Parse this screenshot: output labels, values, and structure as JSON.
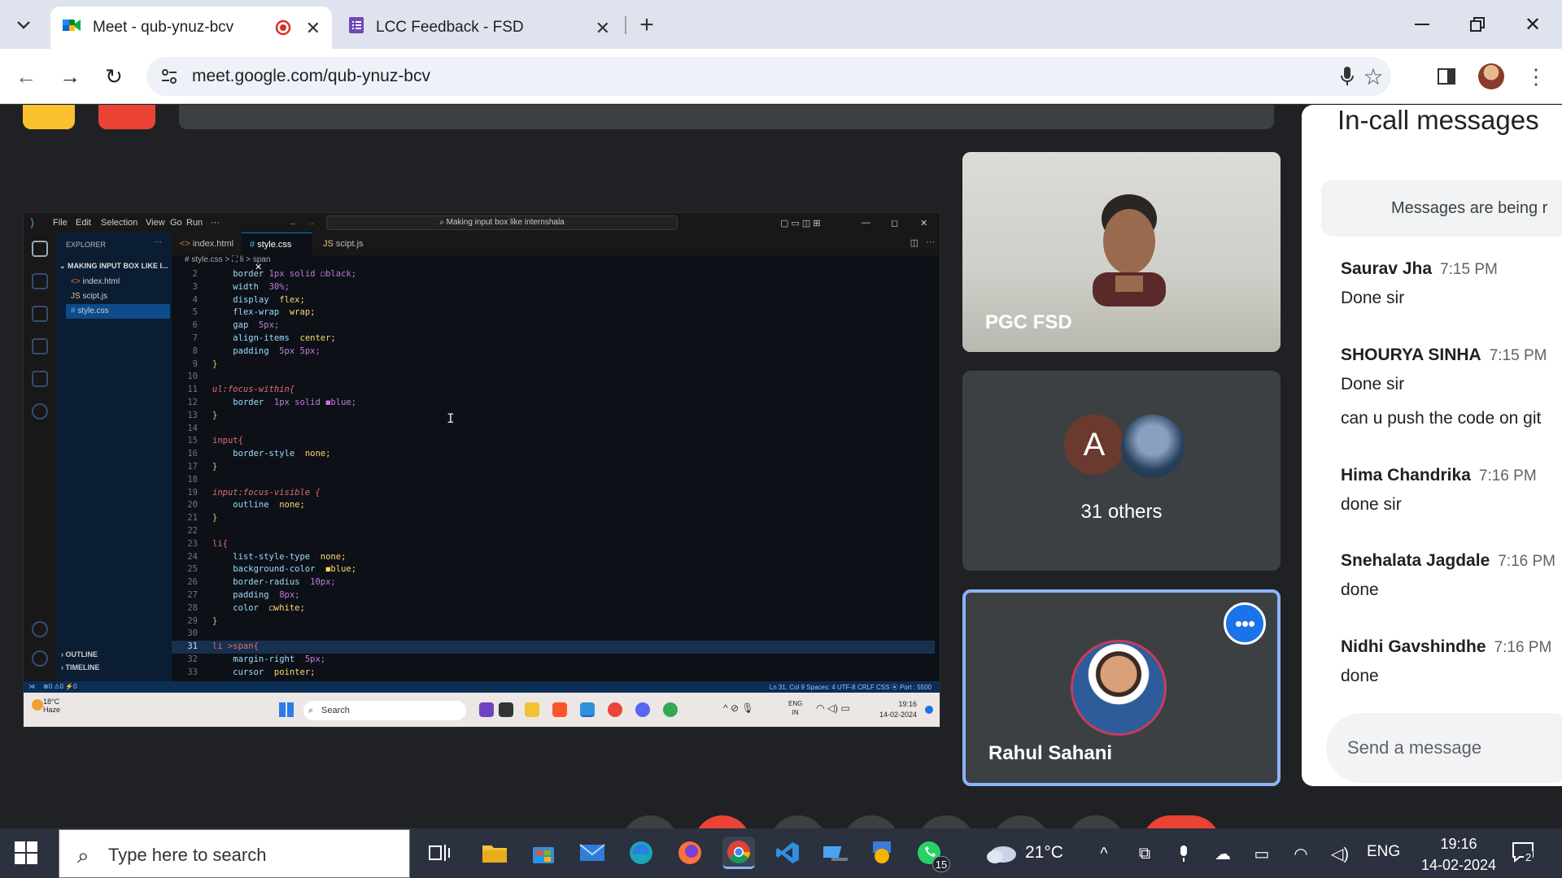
{
  "browser": {
    "tabs": [
      {
        "title": "Meet - qub-ynuz-bcv",
        "active": true,
        "recording": true
      },
      {
        "title": "LCC Feedback - FSD",
        "active": false
      }
    ],
    "url": "meet.google.com/qub-ynuz-bcv"
  },
  "presentation": {
    "menu": [
      "File",
      "Edit",
      "Selection",
      "View",
      "Go",
      "Run",
      "···"
    ],
    "search": "Making input box like internshala",
    "explorer": {
      "header": "EXPLORER",
      "folder": "MAKING INPUT BOX LIKE I...",
      "files": [
        "index.html",
        "scipt.js",
        "style.css"
      ],
      "outline": "OUTLINE",
      "timeline": "TIMELINE"
    },
    "tabs": [
      "index.html",
      "style.css",
      "scipt.js"
    ],
    "breadcrumb": "# style.css > ⛶ li > span",
    "code": [
      {
        "n": "2",
        "t": "    border:1px solid ◻black;"
      },
      {
        "n": "3",
        "t": "    width: 30%;"
      },
      {
        "n": "4",
        "t": "    display: flex;"
      },
      {
        "n": "5",
        "t": "    flex-wrap: wrap;"
      },
      {
        "n": "6",
        "t": "    gap: 5px;"
      },
      {
        "n": "7",
        "t": "    align-items: center;"
      },
      {
        "n": "8",
        "t": "    padding: 5px 5px;"
      },
      {
        "n": "9",
        "t": "}"
      },
      {
        "n": "10",
        "t": ""
      },
      {
        "n": "11",
        "t": "ul:focus-within{"
      },
      {
        "n": "12",
        "t": "    border: 1px solid ◼blue;"
      },
      {
        "n": "13",
        "t": "}"
      },
      {
        "n": "14",
        "t": ""
      },
      {
        "n": "15",
        "t": "input{"
      },
      {
        "n": "16",
        "t": "    border-style: none;"
      },
      {
        "n": "17",
        "t": "}"
      },
      {
        "n": "18",
        "t": ""
      },
      {
        "n": "19",
        "t": "input:focus-visible {"
      },
      {
        "n": "20",
        "t": "    outline: none;"
      },
      {
        "n": "21",
        "t": "}"
      },
      {
        "n": "22",
        "t": ""
      },
      {
        "n": "23",
        "t": "li{"
      },
      {
        "n": "24",
        "t": "    list-style-type: none;"
      },
      {
        "n": "25",
        "t": "    background-color: ◼blue;"
      },
      {
        "n": "26",
        "t": "    border-radius: 10px;"
      },
      {
        "n": "27",
        "t": "    padding: 8px;"
      },
      {
        "n": "28",
        "t": "    color: ◻white;"
      },
      {
        "n": "29",
        "t": "}"
      },
      {
        "n": "30",
        "t": ""
      },
      {
        "n": "31",
        "t": "li >span{"
      },
      {
        "n": "32",
        "t": "    margin-right: 5px;"
      },
      {
        "n": "33",
        "t": "    cursor: pointer;"
      }
    ],
    "status_right": "Ln 31, Col 9   Spaces: 4   UTF-8   CRLF   CSS   ⦿ Port : 5500",
    "taskbar": {
      "weather_temp": "18°C",
      "weather_desc": "Haze",
      "search": "Search",
      "lang1": "ENG",
      "lang2": "IN",
      "time": "19:16",
      "date": "14-02-2024"
    }
  },
  "participants": [
    {
      "name": "PGC FSD"
    },
    {
      "initial": "A",
      "label": "31 others"
    },
    {
      "name": "Rahul Sahani",
      "more": "•••"
    }
  ],
  "chat": {
    "header": "In-call messages",
    "notice": "Messages are being r",
    "messages": [
      {
        "author": "Saurav Jha",
        "time": "7:15 PM",
        "texts": [
          "Done sir"
        ]
      },
      {
        "author": "SHOURYA SINHA",
        "time": "7:15 PM",
        "texts": [
          "Done sir",
          "can u push the code on git"
        ]
      },
      {
        "author": "Hima Chandrika",
        "time": "7:16 PM",
        "texts": [
          "done sir"
        ]
      },
      {
        "author": "Snehalata Jagdale",
        "time": "7:16 PM",
        "texts": [
          "done"
        ]
      },
      {
        "author": "Nidhi Gavshindhe",
        "time": "7:16 PM",
        "texts": [
          "done"
        ]
      }
    ],
    "input_placeholder": "Send a message"
  },
  "taskbar": {
    "search_placeholder": "Type here to search",
    "whatsapp_badge": "15",
    "weather": "21°C",
    "lang": "ENG",
    "time": "19:16",
    "date": "14-02-2024",
    "notifications": "2"
  },
  "colors": {
    "meet_bg": "#202124",
    "accent_blue": "#1a73e8",
    "tile_border": "#8ab4f8"
  }
}
